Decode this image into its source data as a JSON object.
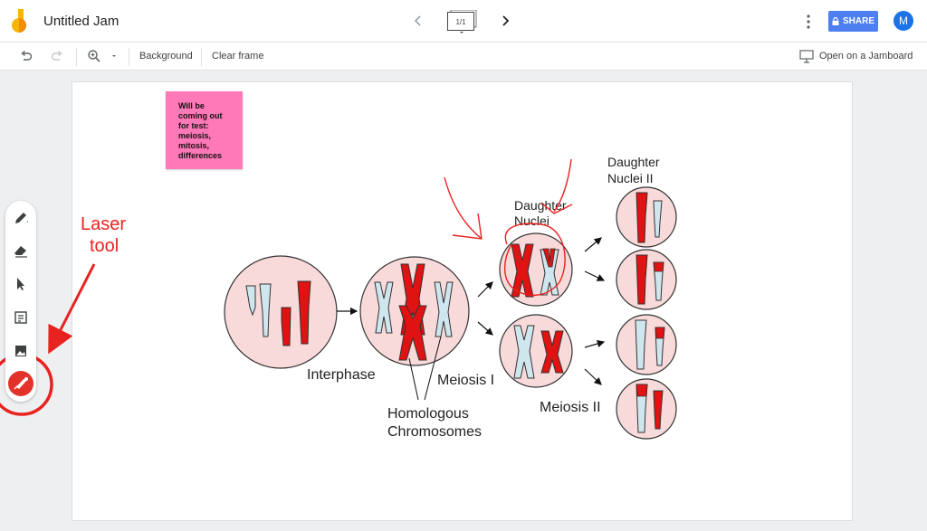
{
  "header": {
    "doc_title": "Untitled Jam",
    "frame_counter": "1/1",
    "share_label": "SHARE",
    "avatar_initial": "M"
  },
  "toolbar": {
    "background_label": "Background",
    "clear_frame_label": "Clear frame",
    "open_on_jamboard_label": "Open on a Jamboard"
  },
  "sticky_note": {
    "text": "Will be coming out for test: meiosis, mitosis, differences",
    "color": "#ff78b7"
  },
  "diagram": {
    "interphase": "Interphase",
    "meiosis_1": "Meiosis I",
    "homologous_1": "Homologous",
    "homologous_2": "Chromosomes",
    "daughter_nuclei_1": "Daughter",
    "daughter_nuclei_2": "Nuclei",
    "daughter_nuclei_ii_1": "Daughter",
    "daughter_nuclei_ii_2": "Nuclei II",
    "meiosis_2": "Meiosis II"
  },
  "annotation": {
    "laser_line_1": "Laser",
    "laser_line_2": "tool"
  },
  "tools": [
    "pen-icon",
    "eraser-icon",
    "select-icon",
    "sticky-note-icon",
    "image-icon",
    "laser-icon"
  ],
  "colors": {
    "accent": "#4d7ff0",
    "laser": "#e2322a",
    "annotation": "#e8231f",
    "chromosome_red": "#e01212",
    "chromosome_blue": "#cfe6ee",
    "nucleus_fill": "#f9dada"
  }
}
